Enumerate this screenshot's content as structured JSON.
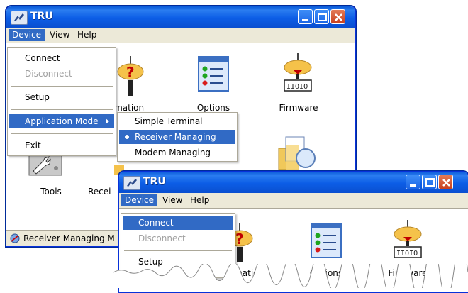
{
  "colors": {
    "titlebar": "#0a5bd8",
    "highlight": "#316ac5",
    "disabled": "#a0a0a0"
  },
  "window1": {
    "title": "TRU",
    "menubar": [
      "Device",
      "View",
      "Help"
    ],
    "device_menu": {
      "items": [
        "Connect",
        "Disconnect",
        "Setup",
        "Application Mode",
        "Exit"
      ]
    },
    "app_mode_submenu": {
      "items": [
        "Simple Terminal",
        "Receiver Managing",
        "Modem Managing"
      ],
      "selected": "Receiver Managing"
    },
    "icons": [
      {
        "label": "ormation",
        "icon": "antenna-question-icon"
      },
      {
        "label": "Options",
        "icon": "options-list-icon"
      },
      {
        "label": "Firmware",
        "icon": "firmware-antenna-icon"
      },
      {
        "label": "Tools",
        "icon": "tools-icon"
      },
      {
        "label": "Recei",
        "icon": "receiver-icon"
      },
      {
        "label": "",
        "icon": "file-search-icon"
      }
    ],
    "status_text": "Receiver Managing M"
  },
  "window2": {
    "title": "TRU",
    "menubar": [
      "Device",
      "View",
      "Help"
    ],
    "device_menu": {
      "items": [
        "Connect",
        "Disconnect",
        "Setup"
      ]
    },
    "icons": [
      {
        "label": "ormation",
        "icon": "antenna-question-icon"
      },
      {
        "label": "Options",
        "icon": "options-list-icon"
      },
      {
        "label": "Firmware",
        "icon": "firmware-antenna-icon"
      }
    ]
  }
}
